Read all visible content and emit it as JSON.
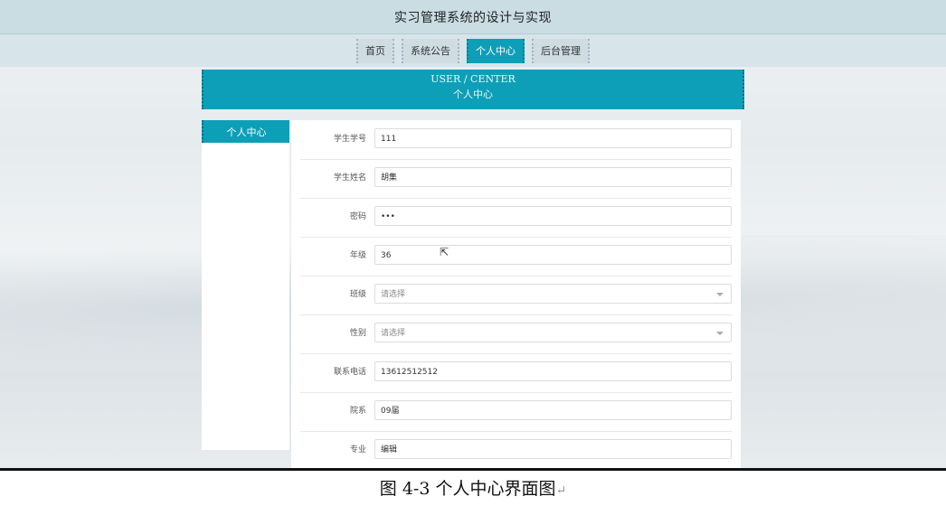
{
  "app": {
    "title": "实习管理系统的设计与实现"
  },
  "nav": {
    "items": [
      {
        "label": "首页"
      },
      {
        "label": "系统公告"
      },
      {
        "label": "个人中心"
      },
      {
        "label": "后台管理"
      }
    ],
    "active_index": 2
  },
  "banner": {
    "en": "USER / CENTER",
    "zh": "个人中心"
  },
  "sidebar": {
    "items": [
      {
        "label": "个人中心"
      }
    ]
  },
  "form": {
    "fields": [
      {
        "label": "学生学号",
        "value": "111"
      },
      {
        "label": "学生姓名",
        "value": "胡集"
      },
      {
        "label": "密码",
        "value": "•••"
      },
      {
        "label": "年级",
        "value": "36"
      },
      {
        "label": "班级",
        "value": "请选择"
      },
      {
        "label": "性别",
        "value": "请选择"
      },
      {
        "label": "联系电话",
        "value": "13612512512"
      },
      {
        "label": "院系",
        "value": "09届"
      },
      {
        "label": "专业",
        "value": "编辑"
      }
    ]
  },
  "caption": {
    "text": "图 4-3 个人中心界面图",
    "mark": "↵"
  }
}
